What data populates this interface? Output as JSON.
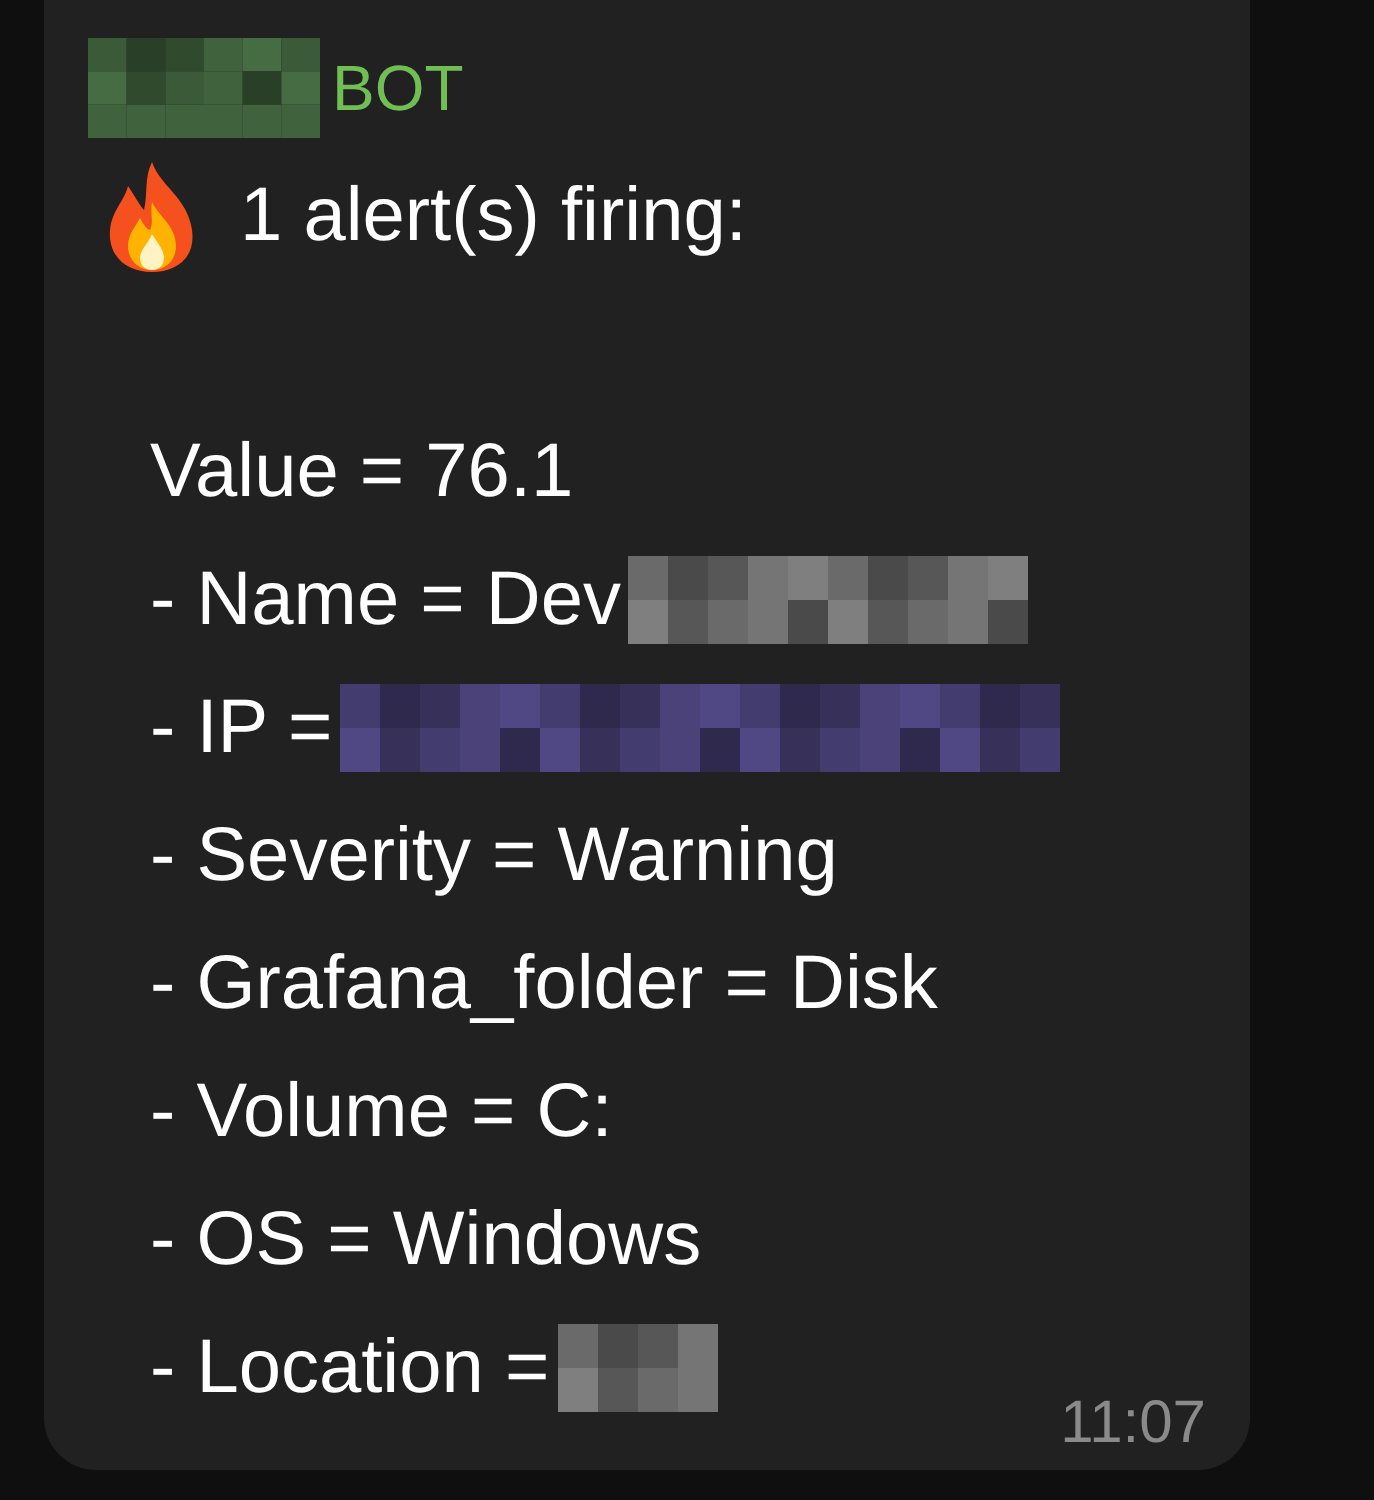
{
  "message": {
    "sender": {
      "name": "BOT",
      "redaction": {
        "color": "#3a5a38"
      }
    },
    "header": "1 alert(s) firing:",
    "lines": [
      {
        "text": "Value = 76.1"
      },
      {
        "text": "- Name = Dev",
        "redaction": {
          "color": "#6a6a6a"
        }
      },
      {
        "text": "- IP =",
        "redaction": {
          "color": "#433c6e"
        }
      },
      {
        "text": "- Severity = Warning"
      },
      {
        "text": "- Grafana_folder = Disk"
      },
      {
        "text": "- Volume = C:"
      },
      {
        "text": "- OS = Windows"
      },
      {
        "text": "- Location =",
        "redaction": {
          "color": "#6a6a6a"
        }
      }
    ],
    "time": "11:07"
  }
}
